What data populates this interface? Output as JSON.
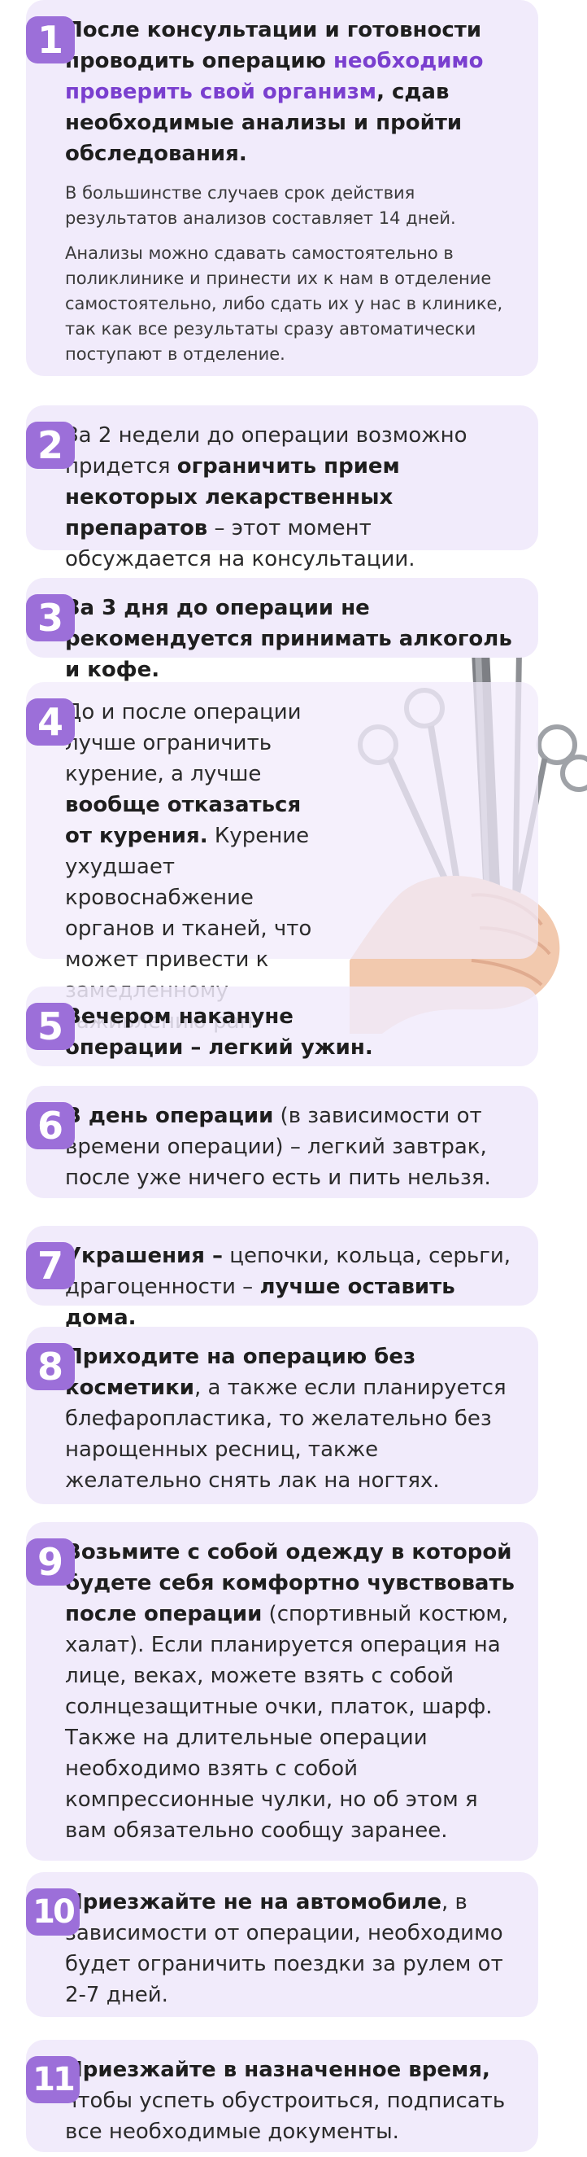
{
  "steps": [
    {
      "number": "1",
      "t1": "После консультации и готовности проводить операцию ",
      "accent": "необходимо проверить свой организм",
      "t2": ", сдав необходимые анализы и пройти обследования.",
      "note1": "В большинстве случаев срок действия результатов анализов составляет 14 дней.",
      "note2": "Анализы можно сдавать самостоятельно в поликлинике и принести их к нам в отделение самостоятельно, либо сдать их у нас в клинике, так как все результаты сразу автоматически поступают в отделение."
    },
    {
      "number": "2",
      "t1": "За 2 недели до операции возможно придется ",
      "b1": "ограничить прием некоторых лекарственных препаратов",
      "t2": " – этот момент обсуждается на консультации."
    },
    {
      "number": "3",
      "b1": "За 3 дня до операции не рекомендуется принимать алкоголь и кофе."
    },
    {
      "number": "4",
      "t1": "До и после операции лучше ограничить курение, а лучше ",
      "b1": "вообще отказаться от курения.",
      "t2": " Курение ухудшает кровоснабжение органов и тканей, что может привести к замедленному заживлению ран."
    },
    {
      "number": "5",
      "b1": "Вечером накануне операции – легкий ужин."
    },
    {
      "number": "6",
      "b1": "В день операции",
      "t1": " (в зависимости от времени операции) – легкий завтрак, после уже ничего есть и пить нельзя."
    },
    {
      "number": "7",
      "b1": "Украшения –",
      "t1": " цепочки, кольца, серьги, драгоценности – ",
      "b2": "лучше оставить дома."
    },
    {
      "number": "8",
      "b1": "Приходите на операцию без косметики",
      "t1": ", а также если планируется блефаропластика, то желательно без нарощенных ресниц, также желательно снять лак на ногтях."
    },
    {
      "number": "9",
      "b1": "Возьмите с собой одежду в которой будете себя комфортно чувствовать после операции",
      "t1": " (спортивный костюм, халат). Если планируется операция на лице, веках, можете взять с собой солнцезащитные очки, платок, шарф. Также на длительные операции необходимо взять с собой компрессионные чулки, но об этом я вам обязательно сообщу заранее."
    },
    {
      "number": "10",
      "b1": "Приезжайте не на автомобиле",
      "t1": ", в зависимости от операции, необходимо будет ограничить поездки за рулем от 2-7 дней."
    },
    {
      "number": "11",
      "b1": "Приезжайте в назначенное время,",
      "t1": " чтобы успеть обустроиться, подписать все необходимые документы."
    }
  ],
  "colors": {
    "accent": "#7a3fcf",
    "badge": "#9c6fd9",
    "card": "#f1ebfb"
  },
  "decor": {
    "image": "hand-holding-surgical-instruments"
  }
}
